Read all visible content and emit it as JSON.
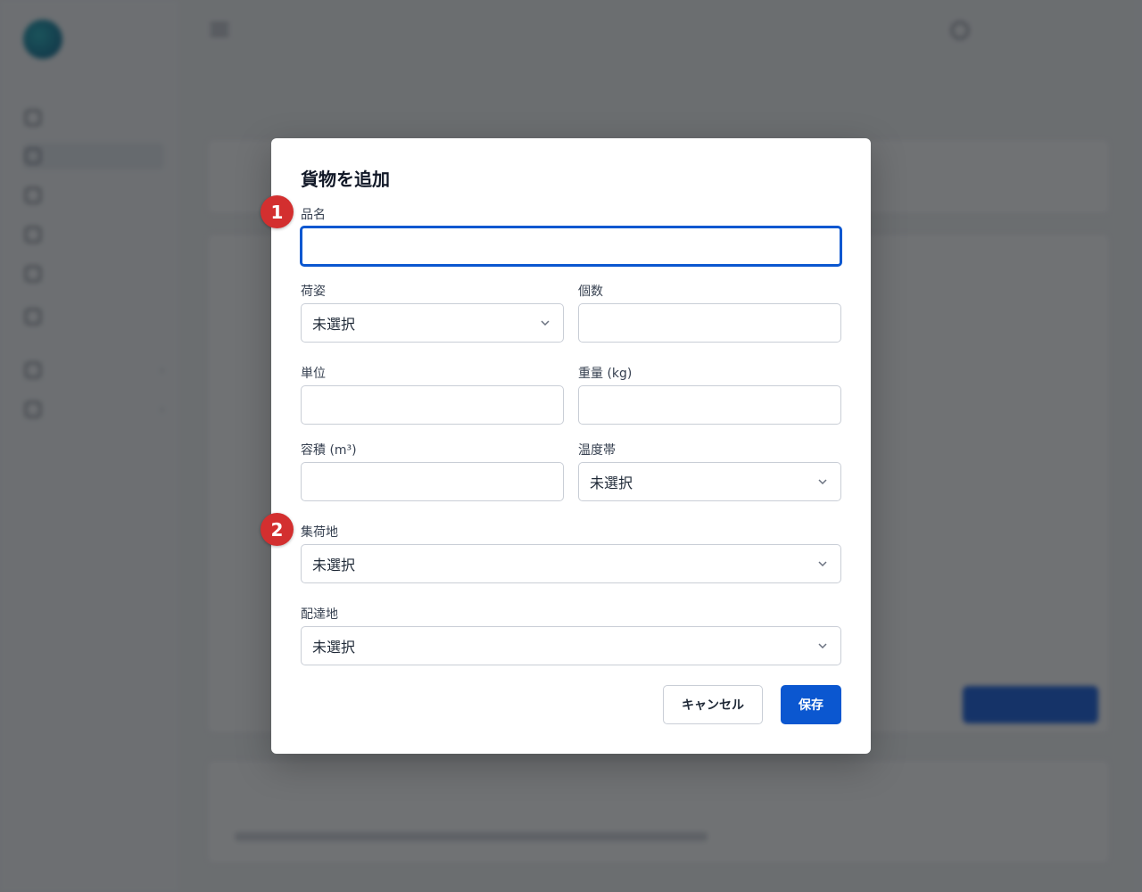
{
  "background": {
    "logo_text": "",
    "nav_items": [
      {
        "label": ""
      },
      {
        "label": ""
      },
      {
        "label": ""
      },
      {
        "label": ""
      },
      {
        "label": ""
      },
      {
        "label": ""
      },
      {
        "label": ""
      },
      {
        "label": ""
      }
    ]
  },
  "modal": {
    "title": "貨物を追加",
    "fields": {
      "item_name": {
        "label": "品名",
        "value": ""
      },
      "packaging": {
        "label": "荷姿",
        "value": "未選択"
      },
      "quantity": {
        "label": "個数",
        "value": ""
      },
      "unit": {
        "label": "単位",
        "value": ""
      },
      "weight": {
        "label": "重量 (kg)",
        "value": ""
      },
      "volume": {
        "label": "容積 (m³)",
        "value": ""
      },
      "temperature": {
        "label": "温度帯",
        "value": "未選択"
      },
      "pickup": {
        "label": "集荷地",
        "value": "未選択"
      },
      "delivery": {
        "label": "配達地",
        "value": "未選択"
      }
    },
    "buttons": {
      "cancel": "キャンセル",
      "save": "保存"
    }
  },
  "markers": [
    "1",
    "2"
  ],
  "colors": {
    "primary": "#0b57d0",
    "marker": "#d32f2f",
    "overlay": "rgba(17,20,24,0.6)"
  }
}
